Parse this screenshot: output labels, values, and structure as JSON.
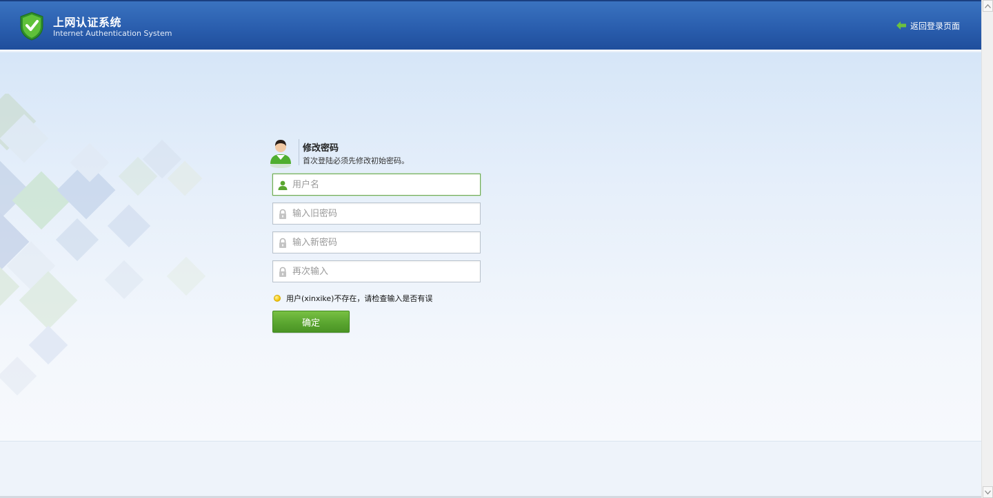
{
  "header": {
    "title": "上网认证系统",
    "subtitle": "Internet Authentication System",
    "back_link_label": "返回登录页面",
    "logo_icon": "shield-check-icon",
    "back_icon": "arrow-left-icon",
    "color_primary": "#2a5eae"
  },
  "form": {
    "title": "修改密码",
    "description": "首次登陆必须先修改初始密码。",
    "avatar_icon": "user-avatar-icon",
    "fields": {
      "username": {
        "placeholder": "用户名",
        "value": "",
        "icon": "user-icon"
      },
      "old_password": {
        "placeholder": "输入旧密码",
        "value": "",
        "icon": "lock-icon"
      },
      "new_password": {
        "placeholder": "输入新密码",
        "value": "",
        "icon": "lock-icon"
      },
      "confirm_password": {
        "placeholder": "再次输入",
        "value": "",
        "icon": "lock-icon"
      }
    },
    "error_message": "用户(xinxike)不存在，请检查输入是否有误",
    "error_icon": "warning-dot-icon",
    "submit_label": "确定",
    "color_accent": "#5aa630"
  }
}
